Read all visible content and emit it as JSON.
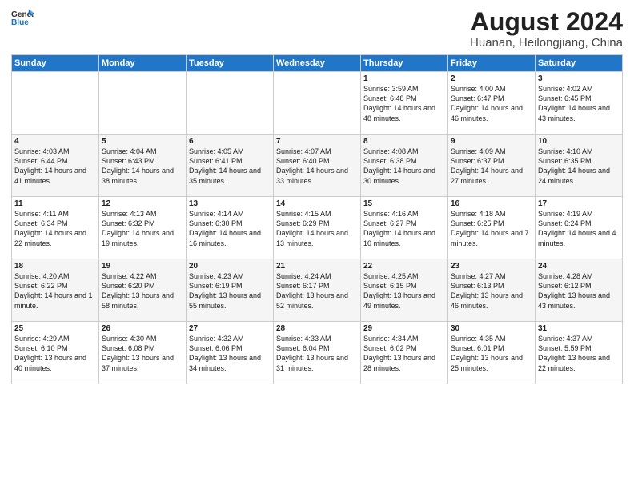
{
  "header": {
    "logo_general": "General",
    "logo_blue": "Blue",
    "main_title": "August 2024",
    "subtitle": "Huanan, Heilongjiang, China"
  },
  "days_of_week": [
    "Sunday",
    "Monday",
    "Tuesday",
    "Wednesday",
    "Thursday",
    "Friday",
    "Saturday"
  ],
  "weeks": [
    [
      {
        "day": "",
        "info": ""
      },
      {
        "day": "",
        "info": ""
      },
      {
        "day": "",
        "info": ""
      },
      {
        "day": "",
        "info": ""
      },
      {
        "day": "1",
        "info": "Sunrise: 3:59 AM\nSunset: 6:48 PM\nDaylight: 14 hours and 48 minutes."
      },
      {
        "day": "2",
        "info": "Sunrise: 4:00 AM\nSunset: 6:47 PM\nDaylight: 14 hours and 46 minutes."
      },
      {
        "day": "3",
        "info": "Sunrise: 4:02 AM\nSunset: 6:45 PM\nDaylight: 14 hours and 43 minutes."
      }
    ],
    [
      {
        "day": "4",
        "info": "Sunrise: 4:03 AM\nSunset: 6:44 PM\nDaylight: 14 hours and 41 minutes."
      },
      {
        "day": "5",
        "info": "Sunrise: 4:04 AM\nSunset: 6:43 PM\nDaylight: 14 hours and 38 minutes."
      },
      {
        "day": "6",
        "info": "Sunrise: 4:05 AM\nSunset: 6:41 PM\nDaylight: 14 hours and 35 minutes."
      },
      {
        "day": "7",
        "info": "Sunrise: 4:07 AM\nSunset: 6:40 PM\nDaylight: 14 hours and 33 minutes."
      },
      {
        "day": "8",
        "info": "Sunrise: 4:08 AM\nSunset: 6:38 PM\nDaylight: 14 hours and 30 minutes."
      },
      {
        "day": "9",
        "info": "Sunrise: 4:09 AM\nSunset: 6:37 PM\nDaylight: 14 hours and 27 minutes."
      },
      {
        "day": "10",
        "info": "Sunrise: 4:10 AM\nSunset: 6:35 PM\nDaylight: 14 hours and 24 minutes."
      }
    ],
    [
      {
        "day": "11",
        "info": "Sunrise: 4:11 AM\nSunset: 6:34 PM\nDaylight: 14 hours and 22 minutes."
      },
      {
        "day": "12",
        "info": "Sunrise: 4:13 AM\nSunset: 6:32 PM\nDaylight: 14 hours and 19 minutes."
      },
      {
        "day": "13",
        "info": "Sunrise: 4:14 AM\nSunset: 6:30 PM\nDaylight: 14 hours and 16 minutes."
      },
      {
        "day": "14",
        "info": "Sunrise: 4:15 AM\nSunset: 6:29 PM\nDaylight: 14 hours and 13 minutes."
      },
      {
        "day": "15",
        "info": "Sunrise: 4:16 AM\nSunset: 6:27 PM\nDaylight: 14 hours and 10 minutes."
      },
      {
        "day": "16",
        "info": "Sunrise: 4:18 AM\nSunset: 6:25 PM\nDaylight: 14 hours and 7 minutes."
      },
      {
        "day": "17",
        "info": "Sunrise: 4:19 AM\nSunset: 6:24 PM\nDaylight: 14 hours and 4 minutes."
      }
    ],
    [
      {
        "day": "18",
        "info": "Sunrise: 4:20 AM\nSunset: 6:22 PM\nDaylight: 14 hours and 1 minute."
      },
      {
        "day": "19",
        "info": "Sunrise: 4:22 AM\nSunset: 6:20 PM\nDaylight: 13 hours and 58 minutes."
      },
      {
        "day": "20",
        "info": "Sunrise: 4:23 AM\nSunset: 6:19 PM\nDaylight: 13 hours and 55 minutes."
      },
      {
        "day": "21",
        "info": "Sunrise: 4:24 AM\nSunset: 6:17 PM\nDaylight: 13 hours and 52 minutes."
      },
      {
        "day": "22",
        "info": "Sunrise: 4:25 AM\nSunset: 6:15 PM\nDaylight: 13 hours and 49 minutes."
      },
      {
        "day": "23",
        "info": "Sunrise: 4:27 AM\nSunset: 6:13 PM\nDaylight: 13 hours and 46 minutes."
      },
      {
        "day": "24",
        "info": "Sunrise: 4:28 AM\nSunset: 6:12 PM\nDaylight: 13 hours and 43 minutes."
      }
    ],
    [
      {
        "day": "25",
        "info": "Sunrise: 4:29 AM\nSunset: 6:10 PM\nDaylight: 13 hours and 40 minutes."
      },
      {
        "day": "26",
        "info": "Sunrise: 4:30 AM\nSunset: 6:08 PM\nDaylight: 13 hours and 37 minutes."
      },
      {
        "day": "27",
        "info": "Sunrise: 4:32 AM\nSunset: 6:06 PM\nDaylight: 13 hours and 34 minutes."
      },
      {
        "day": "28",
        "info": "Sunrise: 4:33 AM\nSunset: 6:04 PM\nDaylight: 13 hours and 31 minutes."
      },
      {
        "day": "29",
        "info": "Sunrise: 4:34 AM\nSunset: 6:02 PM\nDaylight: 13 hours and 28 minutes."
      },
      {
        "day": "30",
        "info": "Sunrise: 4:35 AM\nSunset: 6:01 PM\nDaylight: 13 hours and 25 minutes."
      },
      {
        "day": "31",
        "info": "Sunrise: 4:37 AM\nSunset: 5:59 PM\nDaylight: 13 hours and 22 minutes."
      }
    ]
  ]
}
